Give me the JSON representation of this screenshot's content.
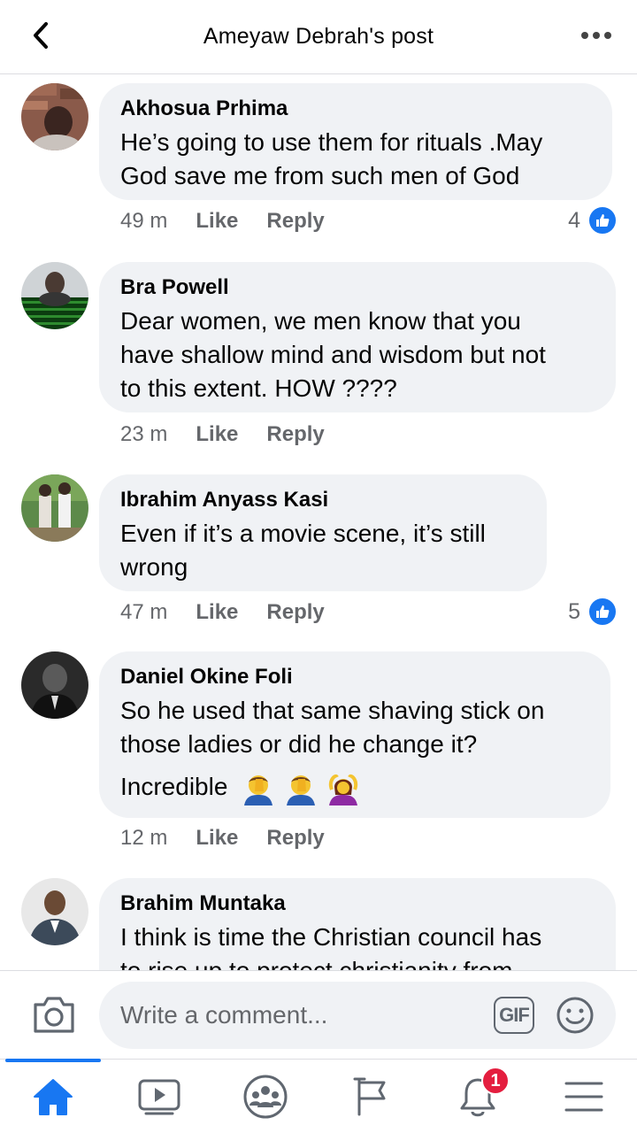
{
  "header": {
    "title": "Ameyaw Debrah's post",
    "back_icon": "chevron-left-icon",
    "more_icon": "more-horizontal-icon"
  },
  "comments": [
    {
      "name": "Akhosua Prhima",
      "lines": [
        "He’s going to use them for rituals .May",
        "God save me from such men of God"
      ],
      "time": "49 m",
      "like": "Like",
      "reply": "Reply",
      "reactions": "4"
    },
    {
      "name": "Bra Powell",
      "lines": [
        "Dear women, we men know that you",
        "have shallow mind and wisdom but not",
        "to this extent. HOW ????"
      ],
      "time": "23 m",
      "like": "Like",
      "reply": "Reply",
      "reactions": ""
    },
    {
      "name": "Ibrahim Anyass Kasi",
      "lines": [
        "Even if it’s a movie scene, it’s still",
        "wrong"
      ],
      "time": "47 m",
      "like": "Like",
      "reply": "Reply",
      "reactions": "5"
    },
    {
      "name": "Daniel Okine Foli",
      "lines": [
        "So he used that same shaving stick on",
        "those ladies or did he change it?",
        "Incredible"
      ],
      "emojis": [
        "facepalm-emoji",
        "facepalm-emoji",
        "woman-gesturing-ok-emoji"
      ],
      "time": "12 m",
      "like": "Like",
      "reply": "Reply",
      "reactions": ""
    },
    {
      "name": "Brahim Muntaka",
      "lines": [
        "I think is time the Christian council has",
        "to rise up to protect christianity from"
      ],
      "time": "",
      "like": "",
      "reply": "",
      "reactions": ""
    }
  ],
  "composer": {
    "placeholder": "Write a comment...",
    "gif_label": "GIF",
    "camera_icon": "camera-icon",
    "emoji_icon": "smiley-icon"
  },
  "tabbar": {
    "items": [
      "home-icon",
      "video-icon",
      "groups-icon",
      "pages-flag-icon",
      "notifications-bell-icon",
      "menu-icon"
    ],
    "notification_count": "1"
  },
  "colors": {
    "accent": "#1877f2",
    "bubble": "#f0f2f5",
    "meta": "#65676b",
    "badge": "#e41e3f"
  }
}
